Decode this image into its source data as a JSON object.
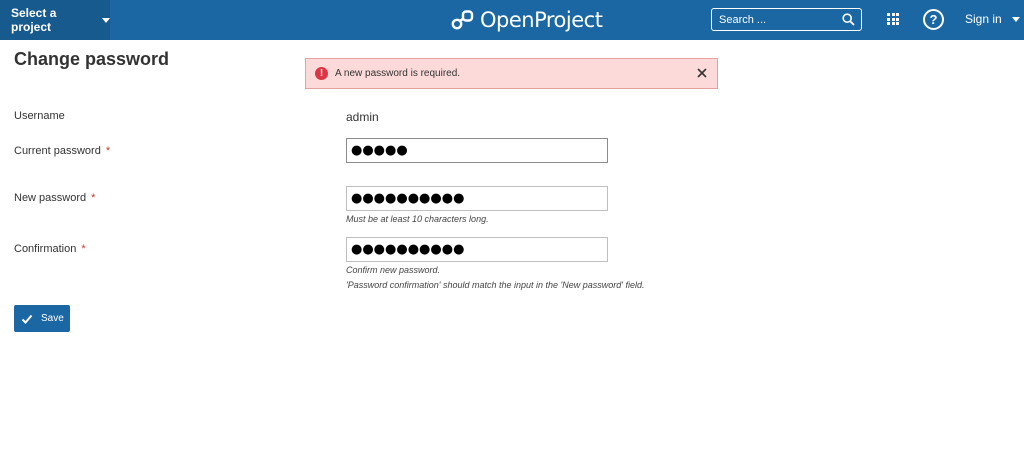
{
  "header": {
    "project_select_label": "Select a project",
    "logo_text": "OpenProject",
    "search_placeholder": "Search ...",
    "help_glyph": "?",
    "sign_in_label": "Sign in",
    "brand_color": "#1a67a3"
  },
  "page": {
    "title": "Change password"
  },
  "flash": {
    "message": "A new password is required.",
    "icon": "error-icon",
    "icon_glyph": "!",
    "close_icon": "close-icon"
  },
  "form": {
    "username_label": "Username",
    "username_value": "admin",
    "current_password_label": "Current password",
    "current_password_value": "●●●●●",
    "new_password_label": "New password",
    "new_password_value": "●●●●●●●●●●",
    "new_password_hint": "Must be at least 10 characters long.",
    "confirmation_label": "Confirmation",
    "confirmation_value": "●●●●●●●●●●",
    "confirmation_hint_1": "Confirm new password.",
    "confirmation_hint_2": "'Password confirmation' should match the input in the 'New password' field.",
    "required_marker": "*",
    "save_label": "Save"
  }
}
